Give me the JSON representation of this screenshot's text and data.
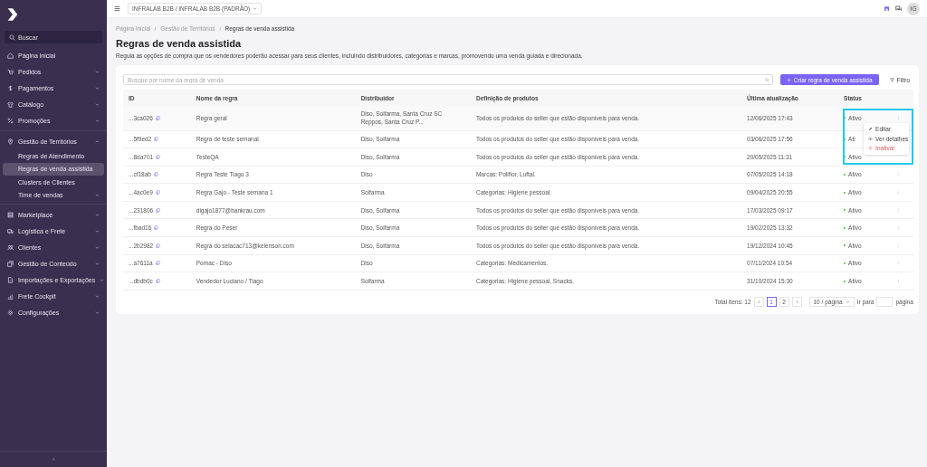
{
  "sidebar": {
    "search_placeholder": "Buscar",
    "items": [
      {
        "label": "Página inicial",
        "kind": "link",
        "selected": false
      },
      {
        "label": "Pedidos",
        "kind": "group",
        "expanded": false,
        "selected": false
      },
      {
        "label": "Pagamentos",
        "kind": "group",
        "expanded": false,
        "selected": false
      },
      {
        "label": "Catálogo",
        "kind": "group",
        "expanded": false,
        "selected": false
      },
      {
        "label": "Promoções",
        "kind": "group",
        "expanded": false,
        "selected": false
      },
      {
        "label": "Gestão de Territórios",
        "kind": "group",
        "expanded": true,
        "selected": false,
        "children": [
          {
            "label": "Regras de Atendimento",
            "kind": "link",
            "selected": false
          },
          {
            "label": "Regras de venda assistida",
            "kind": "link",
            "selected": true
          },
          {
            "label": "Clusters de Clientes",
            "kind": "link",
            "selected": false
          },
          {
            "label": "Time de vendas",
            "kind": "group",
            "expanded": false,
            "selected": false
          }
        ]
      },
      {
        "label": "Marketplace",
        "kind": "group",
        "expanded": false,
        "selected": false
      },
      {
        "label": "Logística e Frete",
        "kind": "group",
        "expanded": false,
        "selected": false
      },
      {
        "label": "Clientes",
        "kind": "group",
        "expanded": false,
        "selected": false
      },
      {
        "label": "Gestão de Conteúdo",
        "kind": "group",
        "expanded": false,
        "selected": false
      },
      {
        "label": "Importações e Exportações",
        "kind": "group",
        "expanded": false,
        "selected": false
      },
      {
        "label": "Frete Cockpit",
        "kind": "group",
        "expanded": false,
        "selected": false
      },
      {
        "label": "Configurações",
        "kind": "group",
        "expanded": false,
        "selected": false
      }
    ]
  },
  "header": {
    "workspace": "INFRALAB B2B / INFRALAB B2B (PADRÃO)",
    "avatar": "IG"
  },
  "breadcrumb": [
    "Página inicial",
    "Gestão de Territórios",
    "Regras de venda assistida"
  ],
  "page": {
    "title": "Regras de venda assistida",
    "description": "Regula as opções de compra que os vendedores poderão acessar para seus clientes, incluindo distribuidores, categorias e marcas, promovendo uma venda guiada e direcionada."
  },
  "toolbar": {
    "search_placeholder": "Busque por nome da regra de venda",
    "create_button": "Criar regra de venda assistida",
    "filter_button": "Filtro"
  },
  "table": {
    "columns": [
      "ID",
      "Nome da regra",
      "Distribuidor",
      "Definição de produtos",
      "Última atualização",
      "Status"
    ],
    "rows": [
      {
        "id": "...3ca026",
        "name": "Regra geral",
        "distributor": "Diso, Solfarma, Santa Cruz SC Reppos, Santa Cruz P...",
        "products": "Todos os produtos do seller que estão disponíveis para venda.",
        "updated": "12/06/2025 17:43",
        "status": "Ativo",
        "hovered": true
      },
      {
        "id": "...5f9ed2",
        "name": "Regra de teste semanal",
        "distributor": "Diso, Solfarma",
        "products": "Todos os produtos do seller que estão disponíveis para venda.",
        "updated": "03/06/2025 17:56",
        "status": "Ati",
        "hovered": false
      },
      {
        "id": "...8da701",
        "name": "TesteQA",
        "distributor": "Diso, Solfarma",
        "products": "Todos os produtos do seller que estão disponíveis para venda.",
        "updated": "20/05/2025 11:31",
        "status": "Ativo",
        "hovered": false
      },
      {
        "id": "...cf18ab",
        "name": "Regra Teste Tiago 3",
        "distributor": "Diso",
        "products": "Marcas: Polifior, Luftal.",
        "updated": "07/05/2025 14:18",
        "status": "Ativo",
        "hovered": false
      },
      {
        "id": "...4ac0e9",
        "name": "Regra Gajo - Teste semana 1",
        "distributor": "Solfarma",
        "products": "Categorias: Higiene pessoal.",
        "updated": "09/04/2025 20:55",
        "status": "Ativo",
        "hovered": false
      },
      {
        "id": "...231806",
        "name": "digajo1877@bankrau.com",
        "distributor": "Diso, Solfarma",
        "products": "Todos os produtos do seller que estão disponíveis para venda.",
        "updated": "17/03/2025 09:17",
        "status": "Ativo",
        "hovered": false
      },
      {
        "id": "...fbad16",
        "name": "Regra do Peser",
        "distributor": "Diso, Solfarma",
        "products": "Todos os produtos do seller que estão disponíveis para venda.",
        "updated": "19/02/2025 13:32",
        "status": "Ativo",
        "hovered": false
      },
      {
        "id": "...2b2982",
        "name": "Regra do selacac713@kelenson.com",
        "distributor": "Diso, Solfarma",
        "products": "Todos os produtos do seller que estão disponíveis para venda.",
        "updated": "19/12/2024 10:45",
        "status": "Ativo",
        "hovered": false
      },
      {
        "id": "...a7611a",
        "name": "Pomac - Diso",
        "distributor": "Diso",
        "products": "Categorias: Medicamentos.",
        "updated": "07/11/2024 10:54",
        "status": "Ativo",
        "hovered": false
      },
      {
        "id": "...dbdb0c",
        "name": "Vendedor Luciano / Tiago",
        "distributor": "Solfarma",
        "products": "Categorias: Higiene pessoal, Snacks.",
        "updated": "31/10/2024 15:30",
        "status": "Ativo",
        "hovered": false
      }
    ]
  },
  "row_menu": {
    "items": [
      {
        "label": "Editar",
        "kind": "edit"
      },
      {
        "label": "Ver detalhes",
        "kind": "view"
      },
      {
        "label": "Inativar",
        "kind": "danger"
      }
    ]
  },
  "pagination": {
    "total": "Total itens: 12",
    "pages": [
      {
        "label": "1",
        "selected": true
      },
      {
        "label": "2",
        "selected": false
      }
    ],
    "page_size": "10 / página",
    "goto_label": "Ir para",
    "page_label": "página"
  }
}
